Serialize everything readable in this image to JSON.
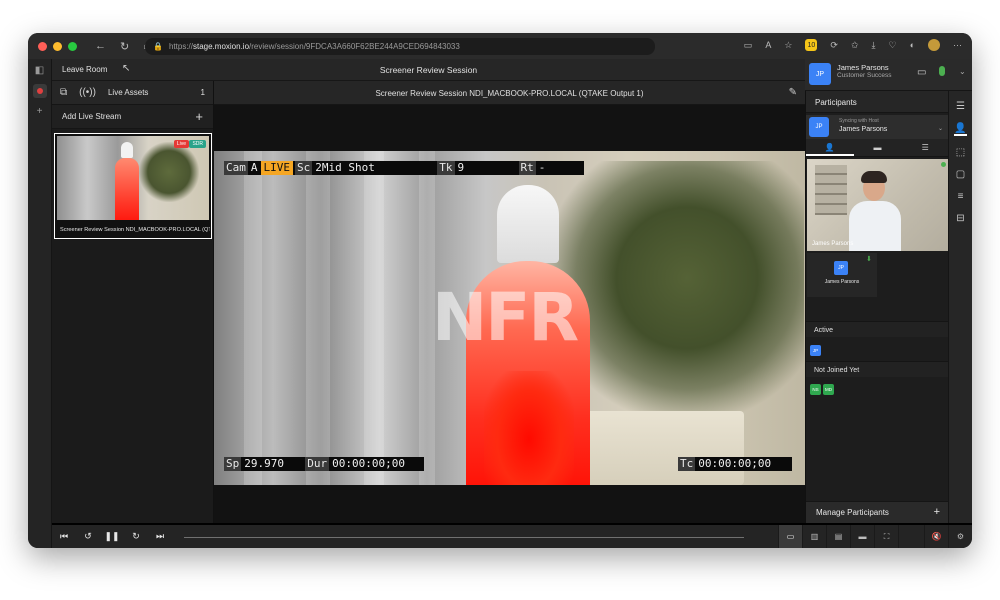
{
  "browser": {
    "url_prefix": "https://",
    "url_host": "stage.moxion.io",
    "url_path": "/review/session/9FDCA3A660F62BE244A9CED694843033",
    "ext_badge": "10"
  },
  "topbar": {
    "leave_label": "Leave Room",
    "room_title": "Screener Review Session"
  },
  "sidebar": {
    "live_assets_label": "Live Assets",
    "live_assets_count": "1",
    "add_stream_label": "Add Live Stream",
    "thumb_caption": "Screener Review Session NDI_MACBOOK-PRO.LOCAL (QT",
    "badge_live": "Live",
    "badge_sdr": "SDR"
  },
  "viewer": {
    "title": "Screener Review Session NDI_MACBOOK-PRO.LOCAL (QTAKE Output 1)",
    "watermark": "NFR",
    "hud": {
      "cam_label": "Cam",
      "cam_value": "A",
      "live_label": "LIVE",
      "sc_label": "Sc",
      "sc_value": "2Mid Shot",
      "tk_label": "Tk",
      "tk_value": "9",
      "rt_label": "Rt",
      "rt_value": "-",
      "sp_label": "Sp",
      "sp_value": "29.970",
      "dur_label": "Dur",
      "dur_value": "00:00:00;00",
      "tc_label": "Tc",
      "tc_value": "00:00:00;00"
    }
  },
  "user": {
    "initials": "JP",
    "name": "James Parsons",
    "role": "Customer Success"
  },
  "participants": {
    "header": "Participants",
    "host_sub": "Syncing with Host",
    "host_name": "James Parsons",
    "video_name": "James Parsons",
    "tile_name": "James Parsons",
    "active_label": "Active",
    "active_chips": [
      "JP"
    ],
    "not_joined_label": "Not Joined Yet",
    "not_joined_chips": [
      "NS",
      "MD"
    ],
    "manage_label": "Manage Participants"
  },
  "colors": {
    "accent_blue": "#3b82f6",
    "live_orange": "#f5a623",
    "live_red": "#e53935",
    "sdr_teal": "#2aa38a",
    "mic_green": "#4caf50"
  }
}
